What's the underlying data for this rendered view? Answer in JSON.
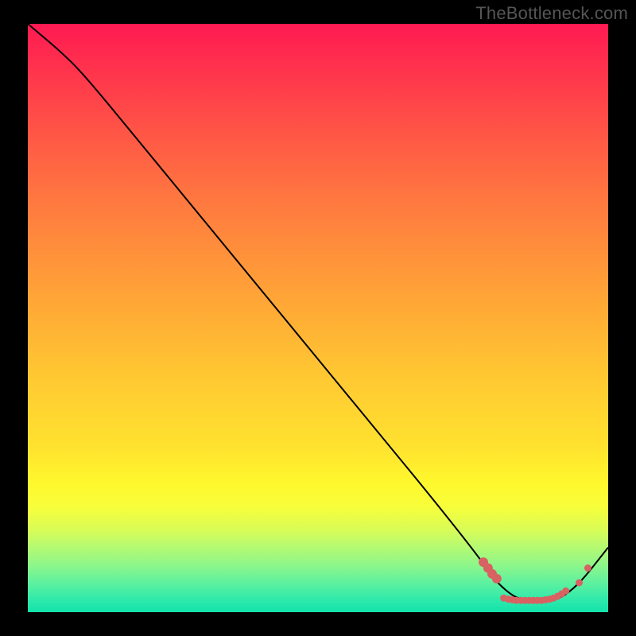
{
  "watermark": "TheBottleneck.com",
  "chart_data": {
    "type": "line",
    "title": "",
    "xlabel": "",
    "ylabel": "",
    "xlim": [
      0,
      100
    ],
    "ylim": [
      0,
      100
    ],
    "grid": false,
    "series": [
      {
        "name": "curve",
        "x": [
          0,
          6,
          10,
          20,
          30,
          40,
          50,
          60,
          70,
          78,
          80,
          82,
          84,
          86,
          88,
          90,
          92,
          94,
          96,
          100
        ],
        "y": [
          100,
          95,
          91,
          79,
          67,
          55,
          43,
          31,
          19,
          9,
          6,
          4,
          2.5,
          2,
          2,
          2,
          2.5,
          4,
          6,
          11
        ]
      },
      {
        "name": "dots-left-cluster",
        "type": "scatter",
        "x": [
          78.5,
          79.3,
          80.0,
          80.8
        ],
        "y": [
          8.5,
          7.5,
          6.5,
          5.7
        ]
      },
      {
        "name": "dots-bottom-run",
        "type": "scatter",
        "x": [
          82.0,
          82.8,
          83.5,
          84.2,
          85.0,
          85.7,
          86.4,
          87.1,
          87.8,
          88.5,
          89.2,
          89.9,
          90.6,
          91.3,
          92.0,
          92.7
        ],
        "y": [
          2.4,
          2.2,
          2.1,
          2.0,
          2.0,
          2.0,
          2.0,
          2.0,
          2.0,
          2.0,
          2.1,
          2.2,
          2.4,
          2.7,
          3.1,
          3.6
        ]
      },
      {
        "name": "dots-right-pair",
        "type": "scatter",
        "x": [
          95.0,
          96.5
        ],
        "y": [
          5.0,
          7.5
        ]
      }
    ]
  }
}
